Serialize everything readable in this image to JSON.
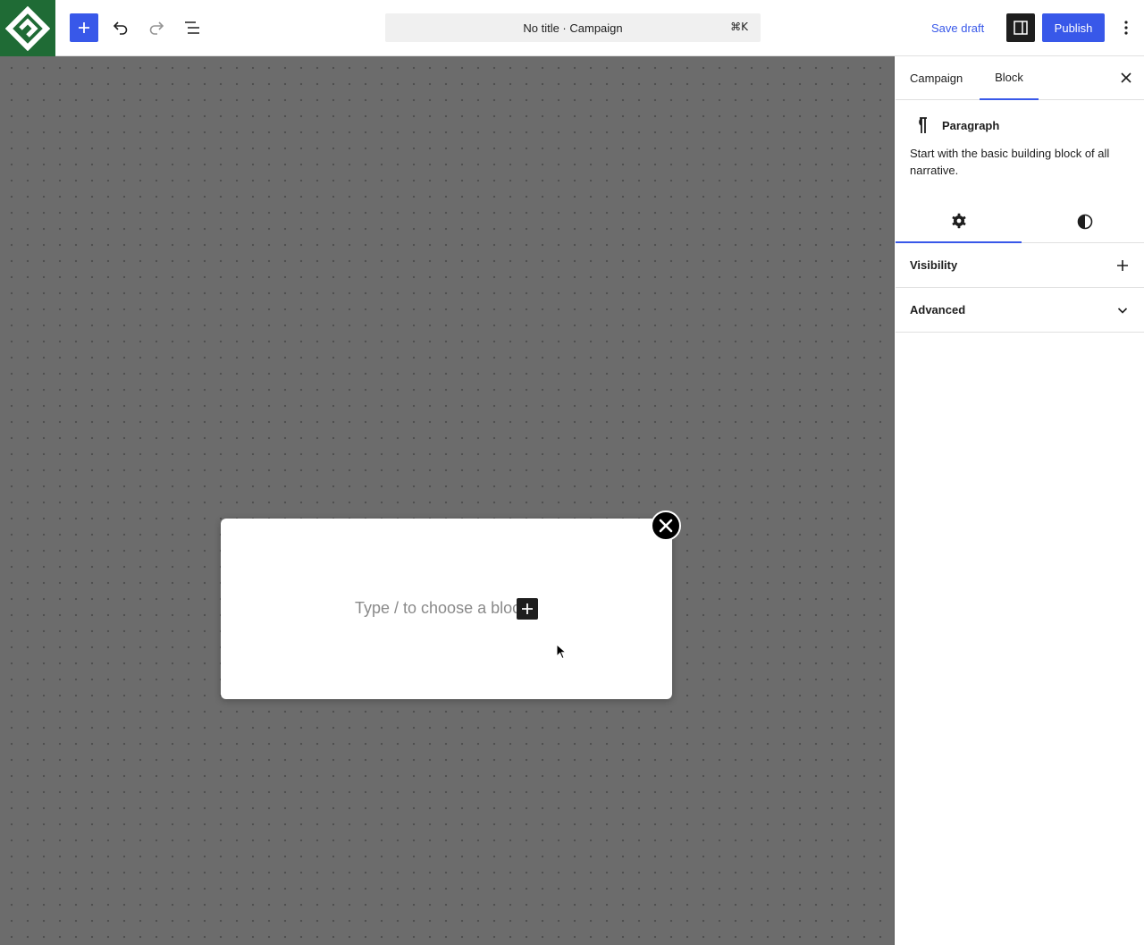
{
  "topbar": {
    "document_title": "No title · Campaign",
    "shortcut": "⌘K",
    "save_draft_label": "Save draft",
    "publish_label": "Publish"
  },
  "canvas": {
    "placeholder": "Type / to choose a block"
  },
  "sidebar": {
    "tabs": [
      {
        "label": "Campaign"
      },
      {
        "label": "Block"
      }
    ],
    "active_tab": "Block",
    "block": {
      "title": "Paragraph",
      "description": "Start with the basic building block of all narrative."
    },
    "panels": [
      {
        "label": "Visibility"
      },
      {
        "label": "Advanced"
      }
    ]
  },
  "colors": {
    "accent": "#3858e9",
    "logo_bg": "#1f6b35",
    "canvas_bg": "#6c6c6c"
  },
  "icons": {
    "logo": "site-logo-icon",
    "add": "plus-icon",
    "undo": "undo-icon",
    "redo": "redo-icon",
    "list_view": "list-view-icon",
    "sidebar": "sidebar-toggle-icon",
    "more": "more-vertical-icon",
    "close": "close-icon",
    "paragraph": "paragraph-icon",
    "settings": "gear-icon",
    "styles": "contrast-icon",
    "expand": "plus-icon",
    "chevron": "chevron-down-icon"
  }
}
